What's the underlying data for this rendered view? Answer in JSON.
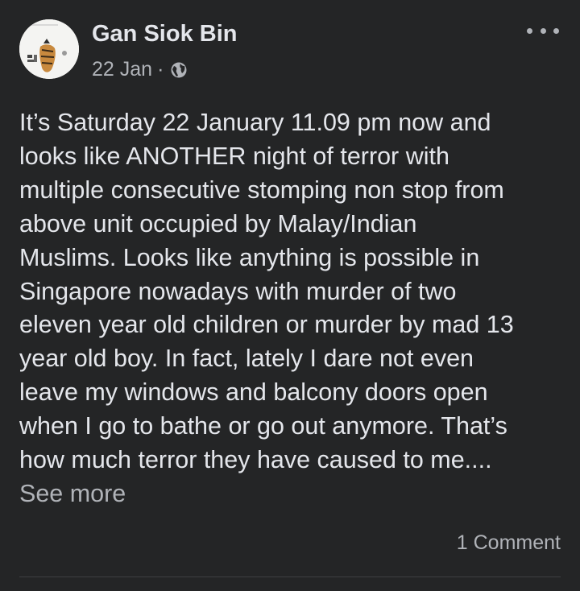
{
  "post": {
    "author": "Gan Siok Bin",
    "date": "22 Jan",
    "separator": "·",
    "audience_icon": "globe-icon",
    "more_icon": "more-horizontal-icon",
    "body": "It’s Saturday 22 January 11.09 pm now and\nlooks like ANOTHER night of terror with\nmultiple consecutive stomping non stop from\nabove unit occupied by Malay/Indian\nMuslims.  Looks like anything is possible in\nSingapore nowadays with murder of two\neleven year old children or murder by mad 13\nyear old boy. In fact, lately I dare not even\nleave my windows and balcony doors open\nwhen I go to bathe or go out anymore. That’s\nhow much terror they have caused to me....",
    "see_more": "See more",
    "comment_count": "1 Comment"
  },
  "colors": {
    "background": "#242526",
    "primary_text": "#e4e6eb",
    "secondary_text": "#b0b3b8",
    "divider": "#3e4042"
  }
}
